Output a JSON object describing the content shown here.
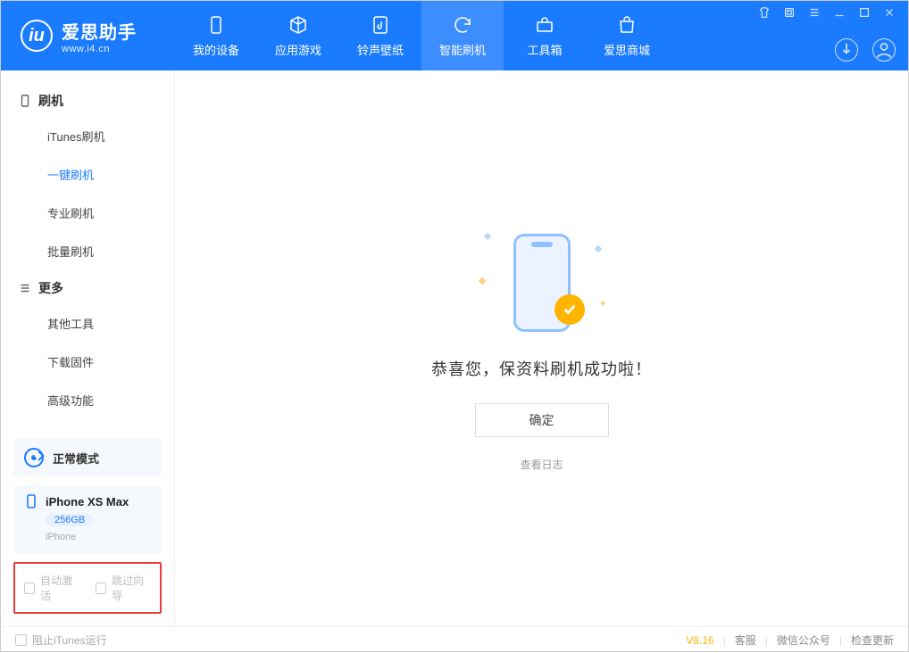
{
  "app": {
    "name_cn": "爱思助手",
    "url": "www.i4.cn"
  },
  "nav": {
    "items": [
      {
        "label": "我的设备"
      },
      {
        "label": "应用游戏"
      },
      {
        "label": "铃声壁纸"
      },
      {
        "label": "智能刷机"
      },
      {
        "label": "工具箱"
      },
      {
        "label": "爱思商城"
      }
    ],
    "active_index": 3
  },
  "sidebar": {
    "groups": [
      {
        "title": "刷机",
        "items": [
          {
            "label": "iTunes刷机"
          },
          {
            "label": "一键刷机"
          },
          {
            "label": "专业刷机"
          },
          {
            "label": "批量刷机"
          }
        ],
        "active_index": 1
      },
      {
        "title": "更多",
        "items": [
          {
            "label": "其他工具"
          },
          {
            "label": "下载固件"
          },
          {
            "label": "高级功能"
          }
        ]
      }
    ],
    "mode_label": "正常模式",
    "device": {
      "name": "iPhone XS Max",
      "capacity": "256GB",
      "type": "iPhone"
    },
    "options": {
      "auto_activate": "自动激活",
      "skip_guide": "跳过向导"
    }
  },
  "main": {
    "success_text": "恭喜您，保资料刷机成功啦！",
    "ok_label": "确定",
    "view_log_label": "查看日志"
  },
  "footer": {
    "block_itunes": "阻止iTunes运行",
    "version": "V8.16",
    "links": {
      "support": "客服",
      "wechat": "微信公众号",
      "update": "检查更新"
    }
  }
}
